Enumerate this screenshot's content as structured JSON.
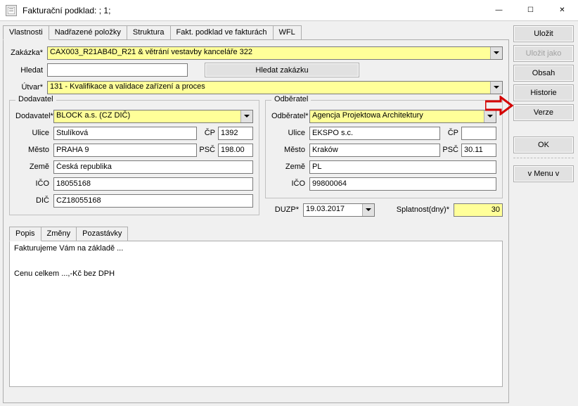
{
  "window": {
    "title": "Fakturační podklad: ; 1;"
  },
  "tabs": {
    "t0": "Vlastnosti",
    "t1": "Nadřazené položky",
    "t2": "Struktura",
    "t3": "Fakt. podklad ve fakturách",
    "t4": "WFL"
  },
  "top": {
    "zakazka_label": "Zakázka*",
    "zakazka_value": "CAX003_R21AB4D_R21 & větrání vestavby kanceláře 322",
    "hledat_label": "Hledat",
    "hledat_value": "",
    "hledat_button": "Hledat zakázku",
    "utvar_label": "Útvar*",
    "utvar_value": "131 - Kvalifikace a validace zařízení a proces"
  },
  "dodavatel": {
    "legend": "Dodavatel",
    "dodavatel_label": "Dodavatel*",
    "dodavatel_value": "BLOCK a.s. (CZ DIČ)",
    "ulice_label": "Ulice",
    "ulice_value": "Stulíková",
    "cp_label": "ČP",
    "cp_value": "1392",
    "mesto_label": "Město",
    "mesto_value": "PRAHA 9",
    "psc_label": "PSČ",
    "psc_value": "198.00",
    "zeme_label": "Země",
    "zeme_value": "Česká republika",
    "ico_label": "IČO",
    "ico_value": "18055168",
    "dic_label": "DIČ",
    "dic_value": "CZ18055168"
  },
  "odberatel": {
    "legend": "Odběratel",
    "odberatel_label": "Odběratel*",
    "odberatel_value": "Agencja Projektowa Architektury",
    "ulice_label": "Ulice",
    "ulice_value": "EKSPO s.c.",
    "cp_label": "ČP",
    "cp_value": "",
    "mesto_label": "Město",
    "mesto_value": "Kraków",
    "psc_label": "PSČ",
    "psc_value": "30.11",
    "zeme_label": "Země",
    "zeme_value": "PL",
    "ico_label": "IČO",
    "ico_value": "99800064"
  },
  "bottom": {
    "duzp_label": "DUZP*",
    "duzp_value": "19.03.2017",
    "splatnost_label": "Splatnost(dny)*",
    "splatnost_value": "30"
  },
  "subtabs": {
    "s0": "Popis",
    "s1": "Změny",
    "s2": "Pozastávky",
    "popis_text": "Fakturujeme Vám na základě ...\n\n\nCenu celkem ...,-Kč bez DPH"
  },
  "buttons": {
    "ulozit": "Uložit",
    "ulozit_jako": "Uložit jako",
    "obsah": "Obsah",
    "historie": "Historie",
    "verze": "Verze",
    "ok": "OK",
    "menu": "v  Menu  v"
  },
  "titlebar_controls": {
    "minimize": "—",
    "maximize": "☐",
    "close": "✕"
  }
}
